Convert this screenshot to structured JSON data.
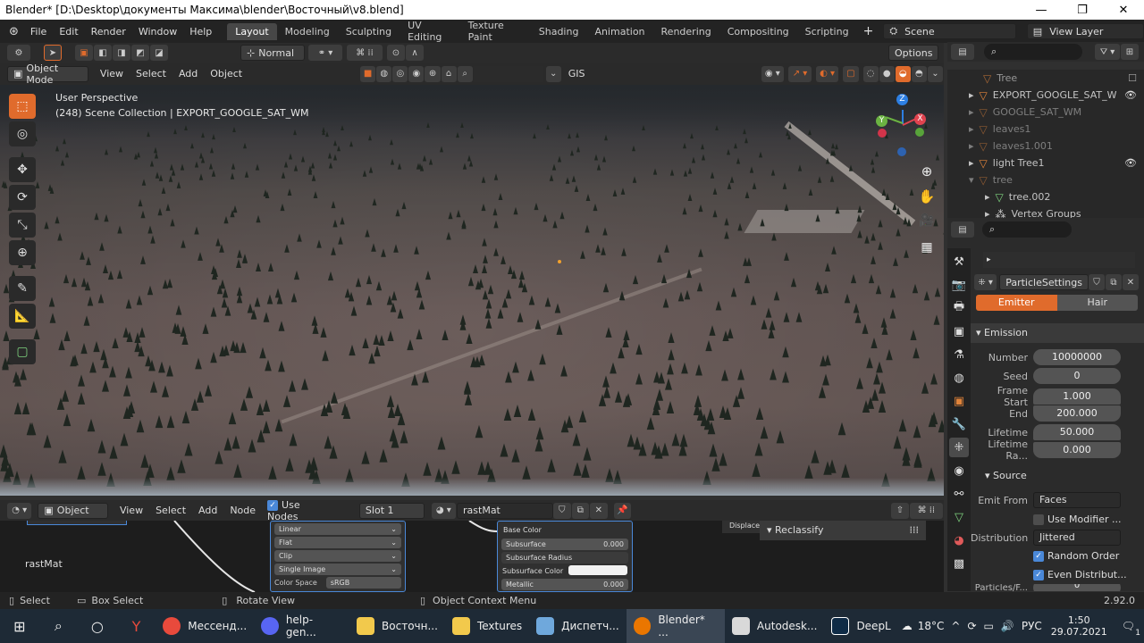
{
  "window": {
    "title": "Blender* [D:\\Desktop\\документы Максима\\blender\\Восточный\\v8.blend]",
    "minimize": "—",
    "maximize": "❐",
    "close": "✕"
  },
  "menu": [
    "File",
    "Edit",
    "Render",
    "Window",
    "Help"
  ],
  "workspaces": [
    "Layout",
    "Modeling",
    "Sculpting",
    "UV Editing",
    "Texture Paint",
    "Shading",
    "Animation",
    "Rendering",
    "Compositing",
    "Scripting"
  ],
  "active_workspace": "Layout",
  "add_workspace": "+",
  "scene": "Scene",
  "view_layer": "View Layer",
  "header": {
    "orientation": "Normal",
    "options": "Options",
    "mode": "Object Mode",
    "view": "View",
    "select": "Select",
    "add": "Add",
    "object": "Object",
    "gis": "GIS"
  },
  "viewport": {
    "perspective": "User Perspective",
    "collection": "(248) Scene Collection | EXPORT_GOOGLE_SAT_WM",
    "axis_x": "X",
    "axis_y": "Y",
    "axis_z": "Z"
  },
  "outliner": {
    "rows": [
      {
        "label": "Tree",
        "icon": "mesh-icon"
      },
      {
        "label": "EXPORT_GOOGLE_SAT_W",
        "icon": "object-icon",
        "eye": "👁"
      },
      {
        "label": "GOOGLE_SAT_WM",
        "icon": "object-icon"
      },
      {
        "label": "leaves1",
        "icon": "mesh-icon"
      },
      {
        "label": "leaves1.001",
        "icon": "mesh-icon"
      },
      {
        "label": "light Tree1",
        "icon": "mesh-icon",
        "eye": "👁"
      },
      {
        "label": "tree",
        "icon": "mesh-icon"
      },
      {
        "label": "tree.002",
        "icon": "mesh-icon"
      },
      {
        "label": "Vertex Groups",
        "icon": "vertex-group-icon"
      }
    ]
  },
  "properties": {
    "particle_settings": "ParticleSettings",
    "emitter": "Emitter",
    "hair": "Hair",
    "emission_title": "Emission",
    "fields": [
      {
        "label": "Number",
        "value": "10000000"
      },
      {
        "label": "Seed",
        "value": "0"
      },
      {
        "label": "Frame Start",
        "value": "1.000"
      },
      {
        "label": "End",
        "value": "200.000"
      },
      {
        "label": "Lifetime",
        "value": "50.000"
      },
      {
        "label": "Lifetime Ra...",
        "value": "0.000"
      }
    ],
    "source_title": "Source",
    "emit_from_label": "Emit From",
    "emit_from": "Faces",
    "use_modifier": "Use Modifier ...",
    "distribution_label": "Distribution",
    "distribution": "Jittered",
    "random_order": "Random Order",
    "even_distribution": "Even Distribut...",
    "particles_face": "Particles/F...",
    "particles_face_value": "0"
  },
  "node_editor": {
    "object": "Object",
    "view": "View",
    "select": "Select",
    "add": "Add",
    "node": "Node",
    "use_nodes": "Use Nodes",
    "slot": "Slot 1",
    "material": "rastMat",
    "node_label": "rastMat",
    "reclassify": "Reclassify",
    "tex_rows": [
      "Linear",
      "Flat",
      "Clip",
      "Single Image"
    ],
    "color_space_label": "Color Space",
    "color_space": "sRGB",
    "bsdf_rows": [
      {
        "label": "Base Color",
        "value": ""
      },
      {
        "label": "Subsurface",
        "value": "0.000"
      },
      {
        "label": "Subsurface Radius",
        "value": ""
      },
      {
        "label": "Subsurface Color",
        "value": ""
      },
      {
        "label": "Metallic",
        "value": "0.000"
      }
    ],
    "displacement": "Displacem"
  },
  "statusbar": {
    "select": "Select",
    "box_select": "Box Select",
    "rotate": "Rotate View",
    "context": "Object Context Menu",
    "version": "2.92.0"
  },
  "taskbar": {
    "apps": [
      {
        "label": "Мессенд...",
        "color": "#e84a3c"
      },
      {
        "label": "help-gen...",
        "color": "#5865f2"
      },
      {
        "label": "Восточн...",
        "color": "#f2c94c"
      },
      {
        "label": "Textures",
        "color": "#f2c94c"
      },
      {
        "label": "Диспетч...",
        "color": "#6fa8dc"
      },
      {
        "label": "Blender* ...",
        "color": "#ea7600"
      },
      {
        "label": "Autodesk...",
        "color": "#d9d9d9"
      },
      {
        "label": "DeepL",
        "color": "#0f2b46"
      }
    ],
    "temperature": "18°C",
    "lang": "РУС",
    "time": "1:50",
    "date": "29.07.2021",
    "notifications": "1"
  },
  "colors": {
    "accent": "#e06b2c",
    "active_tab": "#474747",
    "taskbar": "#1e2a36"
  }
}
